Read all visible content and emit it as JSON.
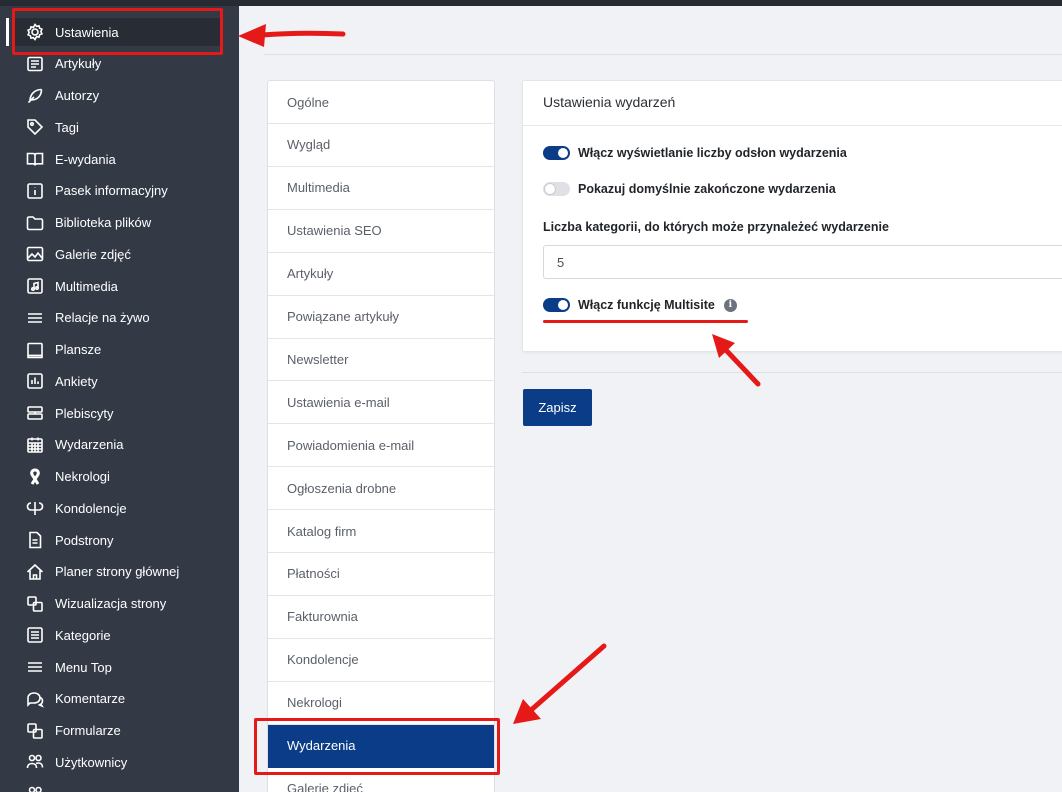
{
  "sidebar": {
    "items": [
      {
        "label": "Ustawienia",
        "icon": "gear-icon"
      },
      {
        "label": "Artykuły",
        "icon": "newspaper-icon"
      },
      {
        "label": "Autorzy",
        "icon": "feather-icon"
      },
      {
        "label": "Tagi",
        "icon": "tag-icon"
      },
      {
        "label": "E-wydania",
        "icon": "book-open-icon"
      },
      {
        "label": "Pasek informacyjny",
        "icon": "info-square-icon"
      },
      {
        "label": "Biblioteka plików",
        "icon": "folder-icon"
      },
      {
        "label": "Galerie zdjęć",
        "icon": "image-icon"
      },
      {
        "label": "Multimedia",
        "icon": "music-file-icon"
      },
      {
        "label": "Relacje na żywo",
        "icon": "lines-icon"
      },
      {
        "label": "Plansze",
        "icon": "board-icon"
      },
      {
        "label": "Ankiety",
        "icon": "poll-chart-icon"
      },
      {
        "label": "Plebiscyty",
        "icon": "layers-icon"
      },
      {
        "label": "Wydarzenia",
        "icon": "calendar-icon"
      },
      {
        "label": "Nekrologi",
        "icon": "ribbon-icon"
      },
      {
        "label": "Kondolencje",
        "icon": "condolence-icon"
      },
      {
        "label": "Podstrony",
        "icon": "document-icon"
      },
      {
        "label": "Planer strony głównej",
        "icon": "home-icon"
      },
      {
        "label": "Wizualizacja strony",
        "icon": "copy-icon"
      },
      {
        "label": "Kategorie",
        "icon": "list-icon"
      },
      {
        "label": "Menu Top",
        "icon": "menu-icon"
      },
      {
        "label": "Komentarze",
        "icon": "comments-icon"
      },
      {
        "label": "Formularze",
        "icon": "copy-icon"
      },
      {
        "label": "Użytkownicy",
        "icon": "users-icon"
      },
      {
        "label": "",
        "icon": "users-icon"
      }
    ]
  },
  "tabs": [
    "Ogólne",
    "Wygląd",
    "Multimedia",
    "Ustawienia SEO",
    "Artykuły",
    "Powiązane artykuły",
    "Newsletter",
    "Ustawienia e-mail",
    "Powiadomienia e-mail",
    "Ogłoszenia drobne",
    "Katalog firm",
    "Płatności",
    "Fakturownia",
    "Kondolencje",
    "Nekrologi",
    "Wydarzenia",
    "Galerie zdjęć"
  ],
  "active_tab": "Wydarzenia",
  "card": {
    "title": "Ustawienia wydarzeń",
    "toggle_views": {
      "label": "Włącz wyświetlanie liczby odsłon wydarzenia",
      "on": true
    },
    "toggle_ended": {
      "label": "Pokazuj domyślnie zakończone wydarzenia",
      "on": false
    },
    "categories_label": "Liczba kategorii, do których może przynależeć wydarzenie",
    "categories_value": "5",
    "toggle_multisite": {
      "label": "Włącz funkcję Multisite",
      "on": true
    },
    "info_glyph": "i"
  },
  "save_label": "Zapisz",
  "colors": {
    "sidebar_bg": "#343a45",
    "primary": "#0b3c87",
    "annotation": "#e61919"
  }
}
